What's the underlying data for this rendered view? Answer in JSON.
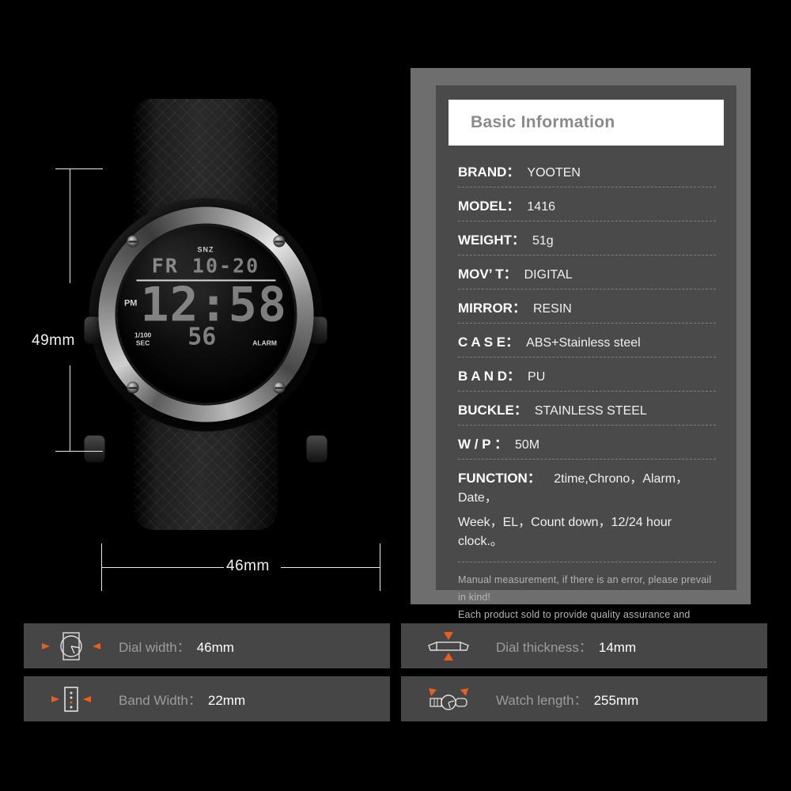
{
  "dimensions": {
    "height_label": "49mm",
    "width_label": "46mm"
  },
  "watch_display": {
    "snooze": "SNZ",
    "date": "FR 10-20",
    "meridiem": "PM",
    "time": "12:58",
    "mode_line1": "1/100",
    "mode_line2": "SEC",
    "seconds": "56",
    "alarm": "ALARM"
  },
  "spec_panel": {
    "title": "Basic Information",
    "rows": [
      {
        "label": "BRAND：",
        "value": "YOOTEN"
      },
      {
        "label": "MODEL：",
        "value": "1416"
      },
      {
        "label": "WEIGHT：",
        "value": "51g"
      },
      {
        "label": "MOV’ T：",
        "value": "DIGITAL"
      },
      {
        "label": "MIRROR：",
        "value": "RESIN"
      },
      {
        "label": "C A S E：",
        "value": "ABS+Stainless steel"
      },
      {
        "label": "B A N D：",
        "value": "PU"
      },
      {
        "label": "BUCKLE：",
        "value": "STAINLESS STEEL"
      },
      {
        "label": "W / P  ：",
        "value": "50M"
      }
    ],
    "function": {
      "label": "FUNCTION：",
      "line1": "2time,Chrono，Alarm，Date，",
      "line2": "Week，EL，Count down，12/24 hour clock.。"
    },
    "notes": [
      "Manual measurement, if there is an error, please prevail in kind!",
      "Each product sold to provide quality assurance and after-sales service!"
    ]
  },
  "feature_cards": [
    {
      "icon": "dial-width-icon",
      "label": "Dial width：",
      "value": "46mm"
    },
    {
      "icon": "dial-thickness-icon",
      "label": "Dial thickness：",
      "value": "14mm"
    },
    {
      "icon": "band-width-icon",
      "label": "Band Width：",
      "value": "22mm"
    },
    {
      "icon": "watch-length-icon",
      "label": "Watch length：",
      "value": "255mm"
    }
  ],
  "colors": {
    "accent_orange": "#e8601c",
    "panel_outer": "#6e6e6e",
    "panel_inner": "#4a4a4a",
    "card_bg": "#464646",
    "background": "#000000"
  }
}
